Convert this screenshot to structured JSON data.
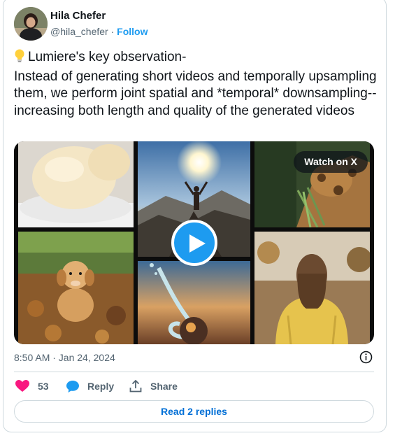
{
  "author": {
    "name": "Hila Chefer",
    "handle": "@hila_chefer",
    "separator": "·",
    "follow_label": "Follow"
  },
  "tweet": {
    "line1": "Lumiere's key observation-",
    "body": "Instead of generating short videos and temporally upsampling them, we perform joint spatial and *temporal* downsampling-- increasing both length and quality of the generated videos"
  },
  "media": {
    "watch_label": "Watch on X",
    "tiles": [
      "ice-cream",
      "hiker-sunrise",
      "giraffe",
      "puppy-leaves",
      "water-splash",
      "woman-yellow-jacket"
    ]
  },
  "meta": {
    "timestamp": "8:50 AM · Jan 24, 2024"
  },
  "actions": {
    "like_count": "53",
    "reply_label": "Reply",
    "share_label": "Share"
  },
  "replies_button": "Read 2 replies",
  "colors": {
    "accent": "#1d9bf0",
    "like": "#f91880",
    "link": "#006fd6",
    "muted": "#536471",
    "border": "#cfd9de"
  },
  "icons": [
    "lightbulb-icon",
    "play-icon",
    "info-icon",
    "heart-icon",
    "reply-bubble-icon",
    "share-icon"
  ]
}
